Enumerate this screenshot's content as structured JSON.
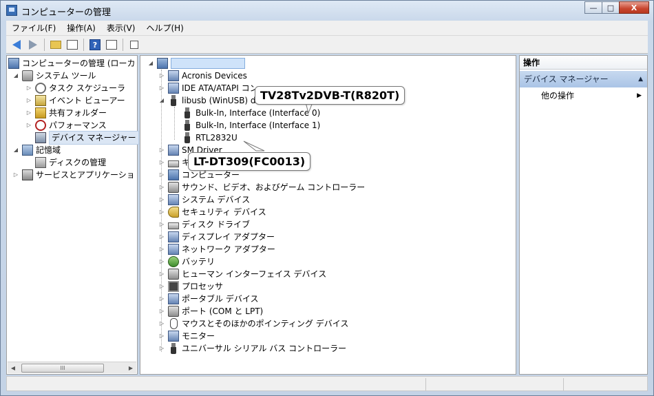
{
  "window": {
    "title": "コンピューターの管理"
  },
  "caption_buttons": {
    "minimize": "—",
    "maximize": "□",
    "close": "X"
  },
  "menu": [
    "ファイル(F)",
    "操作(A)",
    "表示(V)",
    "ヘルプ(H)"
  ],
  "left_tree": {
    "root": "コンピューターの管理 (ローカ",
    "system_tools": "システム ツール",
    "task_scheduler": "タスク スケジューラ",
    "event_viewer": "イベント ビューアー",
    "shared_folders": "共有フォルダー",
    "performance": "パフォーマンス",
    "device_manager": "デバイス マネージャー",
    "storage": "記憶域",
    "disk_management": "ディスクの管理",
    "services_apps": "サービスとアプリケーショ"
  },
  "scrollbar": {
    "left": "◀",
    "thumb": "III",
    "right": "▶"
  },
  "device_tree": {
    "items": [
      "Acronis Devices",
      "IDE ATA/ATAPI コン",
      "libusb (WinUSB) dev",
      "Bulk-In, Interface (Interface 0)",
      "Bulk-In, Interface (Interface 1)",
      "RTL2832U",
      "SM Driver",
      "キ",
      "コンピューター",
      "サウンド、ビデオ、およびゲーム コントローラー",
      "システム デバイス",
      "セキュリティ デバイス",
      "ディスク ドライブ",
      "ディスプレイ アダプター",
      "ネットワーク アダプター",
      "バッテリ",
      "ヒューマン インターフェイス デバイス",
      "プロセッサ",
      "ポータブル デバイス",
      "ポート (COM と LPT)",
      "マウスとそのほかのポインティング デバイス",
      "モニター",
      "ユニバーサル シリアル バス コントローラー"
    ]
  },
  "callouts": {
    "top": "TV28Tv2DVB-T(R820T)",
    "bottom": "LT-DT309(FC0013)"
  },
  "actions": {
    "header": "操作",
    "section": "デバイス マネージャー",
    "item": "他の操作"
  }
}
